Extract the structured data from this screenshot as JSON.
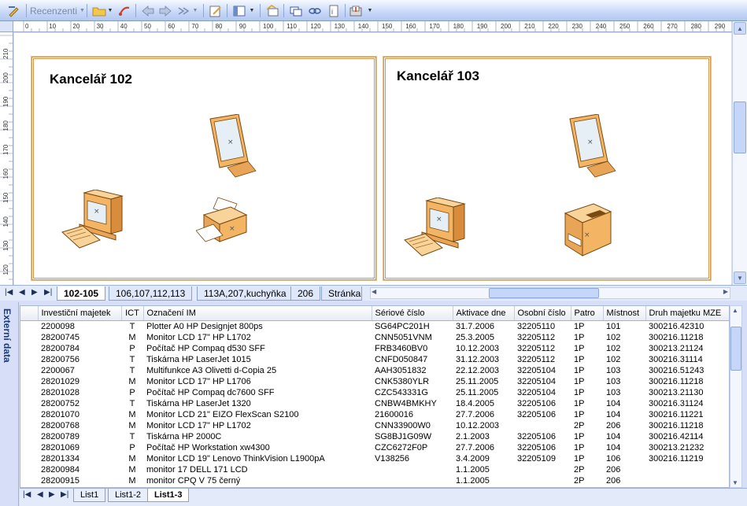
{
  "toolbar": {
    "review_label": "Recenzenti",
    "accent": "#c7d8f7"
  },
  "ruler": {
    "top_ticks": [
      "0",
      "10",
      "20",
      "30",
      "40",
      "50",
      "60",
      "70",
      "80",
      "90",
      "100",
      "110",
      "120",
      "130",
      "140",
      "150",
      "160",
      "170",
      "180",
      "190",
      "200",
      "210",
      "220",
      "230",
      "240",
      "250",
      "260",
      "270",
      "280",
      "290"
    ],
    "left_ticks": [
      "210",
      "200",
      "190",
      "180",
      "170",
      "160",
      "150",
      "140",
      "130",
      "120"
    ]
  },
  "drawing": {
    "rooms": [
      {
        "title": "Kancelář 102"
      },
      {
        "title": "Kancelář 103"
      }
    ],
    "room_border_color": "#d7964c"
  },
  "page_tabs": {
    "tabs": [
      "102-105",
      "106,107,112,113",
      "113A,207,kuchyňka",
      "206",
      "Stránka-"
    ],
    "active": "102-105"
  },
  "external_data": {
    "label": "Externí data",
    "columns": [
      "Investiční majetek",
      "ICT",
      "Označení IM",
      "Sériové číslo",
      "Aktivace dne",
      "Osobní číslo",
      "Patro",
      "Místnost",
      "Druh majetku MZE"
    ],
    "rows": [
      [
        "2200098",
        "T",
        "Plotter A0 HP Designjet 800ps",
        "SG64PC201H",
        "31.7.2006",
        "32205110",
        "1P",
        "101",
        "300216.42310"
      ],
      [
        "28200745",
        "M",
        "Monitor LCD 17\" HP L1702",
        "CNN5051VNM",
        "25.3.2005",
        "32205112",
        "1P",
        "102",
        "300216.11218"
      ],
      [
        "28200784",
        "P",
        "Počítač HP Compaq d530 SFF",
        "FRB3460BV0",
        "10.12.2003",
        "32205112",
        "1P",
        "102",
        "300213.21124"
      ],
      [
        "28200756",
        "T",
        "Tiskárna HP LaserJet 1015",
        "CNFD050847",
        "31.12.2003",
        "32205112",
        "1P",
        "102",
        "300216.31114"
      ],
      [
        "2200067",
        "T",
        "Multifunkce A3 Olivetti d-Copia 25",
        "AAH3051832",
        "22.12.2003",
        "32205104",
        "1P",
        "103",
        "300216.51243"
      ],
      [
        "28201029",
        "M",
        "Monitor LCD 17\" HP L1706",
        "CNK5380YLR",
        "25.11.2005",
        "32205104",
        "1P",
        "103",
        "300216.11218"
      ],
      [
        "28201028",
        "P",
        "Počítač HP Compaq dc7600 SFF",
        "CZC543331G",
        "25.11.2005",
        "32205104",
        "1P",
        "103",
        "300213.21130"
      ],
      [
        "28200752",
        "T",
        "Tiskárna HP LaserJet 1320",
        "CNBW4BMKHY",
        "18.4.2005",
        "32205106",
        "1P",
        "104",
        "300216.31124"
      ],
      [
        "28201070",
        "M",
        "Monitor LCD 21\" EIZO FlexScan S2100",
        "21600016",
        "27.7.2006",
        "32205106",
        "1P",
        "104",
        "300216.11221"
      ],
      [
        "28200768",
        "M",
        "Monitor LCD 17\" HP L1702",
        "CNN33900W0",
        "10.12.2003",
        "",
        "2P",
        "206",
        "300216.11218"
      ],
      [
        "28200789",
        "T",
        "Tiskárna HP 2000C",
        "SG8BJ1G09W",
        "2.1.2003",
        "32205106",
        "1P",
        "104",
        "300216.42114"
      ],
      [
        "28201069",
        "P",
        "Počítač HP Workstation xw4300",
        "CZC6272F0P",
        "27.7.2006",
        "32205106",
        "1P",
        "104",
        "300213.21232"
      ],
      [
        "28201334",
        "M",
        "Monitor LCD 19\" Lenovo ThinkVision L1900pA",
        "V138256",
        "3.4.2009",
        "32205109",
        "1P",
        "106",
        "300216.11219"
      ],
      [
        "28200984",
        "M",
        "monitor 17 DELL 171 LCD",
        "",
        "1.1.2005",
        "",
        "2P",
        "206",
        ""
      ],
      [
        "28200915",
        "M",
        "monitor CPQ V 75 černý",
        "",
        "1.1.2005",
        "",
        "2P",
        "206",
        ""
      ]
    ]
  },
  "sheet_tabs": {
    "tabs": [
      "List1",
      "List1-2",
      "List1-3"
    ],
    "active": "List1-3"
  }
}
